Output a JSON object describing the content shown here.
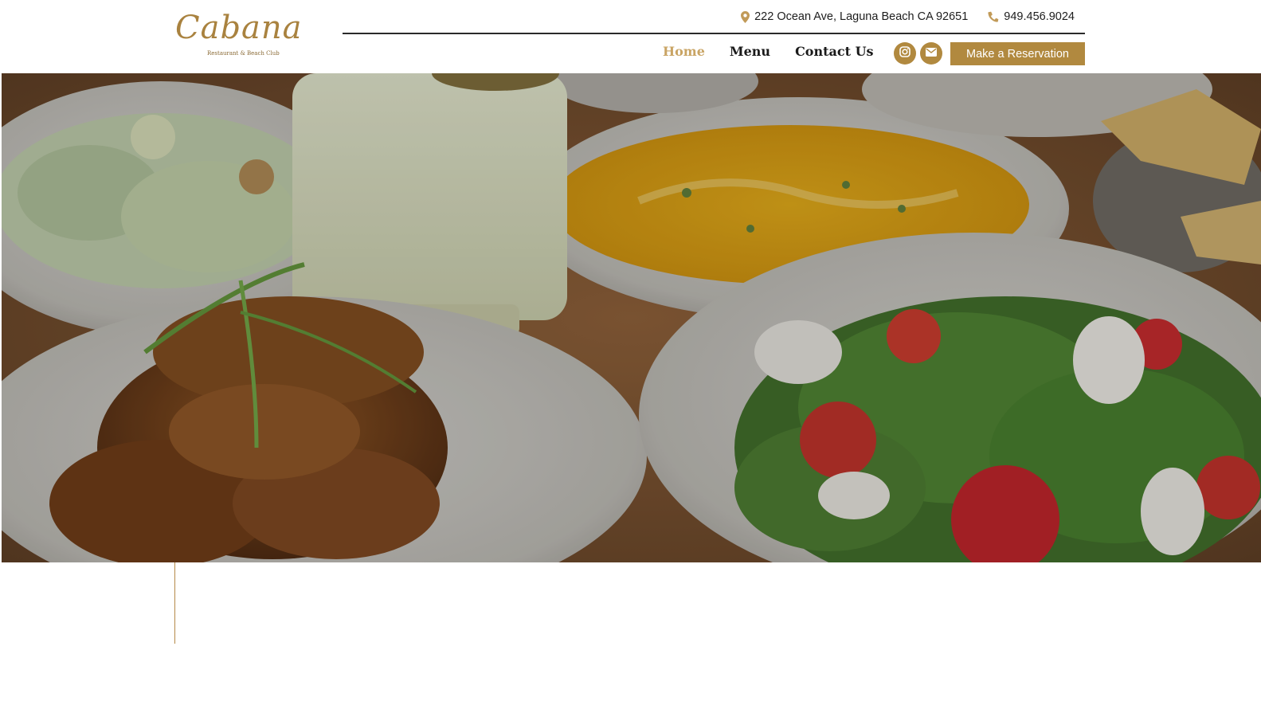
{
  "brand": {
    "logo_text": "Cabana",
    "logo_subtitle": "Restaurant & Beach Club"
  },
  "topbar": {
    "address": "222 Ocean Ave, Laguna Beach CA 92651",
    "phone": "949.456.9024"
  },
  "nav": {
    "items": [
      {
        "label": "Home",
        "active": true
      },
      {
        "label": "Menu",
        "active": false
      },
      {
        "label": "Contact Us",
        "active": false
      }
    ]
  },
  "social": {
    "instagram_icon": "instagram-icon",
    "email_icon": "envelope-icon"
  },
  "cta": {
    "reservation_label": "Make a Reservation"
  },
  "colors": {
    "accent": "#b1893f",
    "nav_active": "#c9a464",
    "text": "#1a1a1a"
  },
  "hero": {
    "image": "table of dishes: chicken wings, lemonade, caesar salad, soup, arugula and tomato salad"
  }
}
